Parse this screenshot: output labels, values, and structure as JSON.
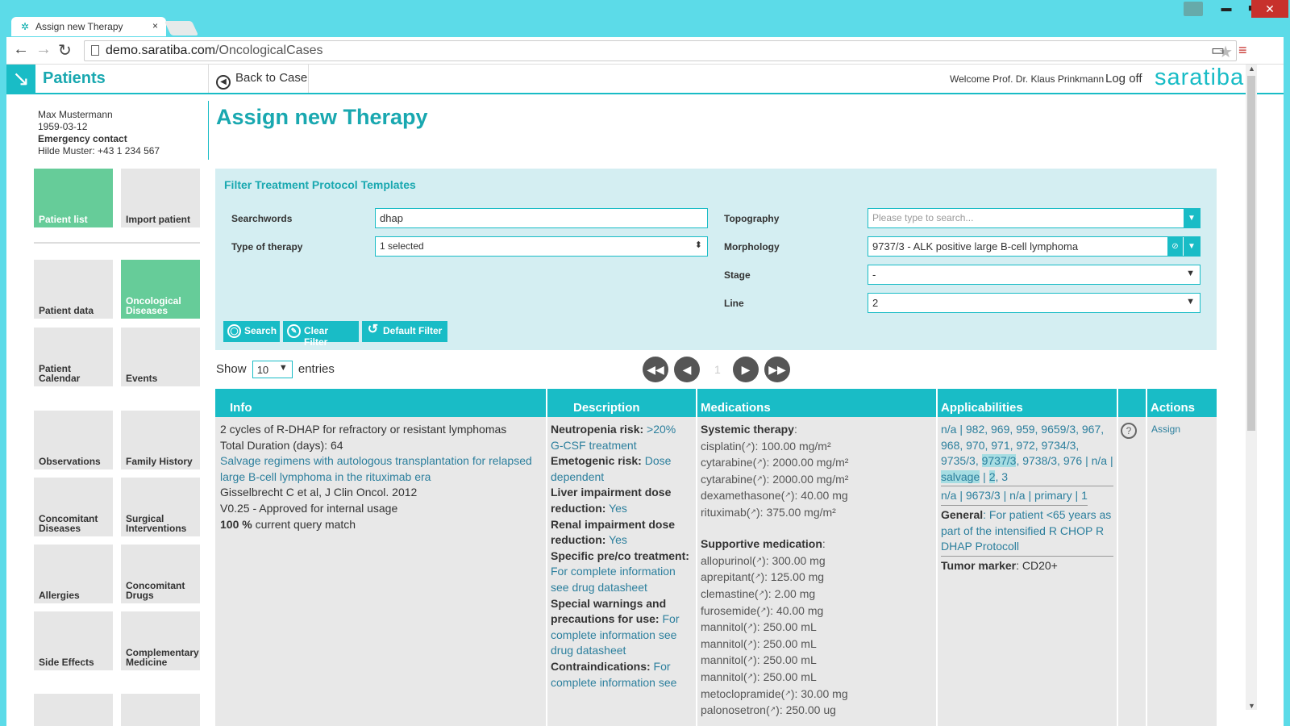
{
  "browser": {
    "tab_title": "Assign new Therapy",
    "tab_close": "×",
    "url_host": "demo.saratiba.com",
    "url_path": "/OncologicalCases",
    "min": "▬",
    "max": "■",
    "close": "✕"
  },
  "header": {
    "app_title": "Patients",
    "back_label": "Back to Case",
    "welcome": "Welcome Prof. Dr. Klaus Prinkmann",
    "logoff": "Log off",
    "brand": "saratiba"
  },
  "patient": {
    "name": "Max Mustermann",
    "dob": "1959-03-12",
    "emergency_label": "Emergency contact",
    "emergency_contact": "Hilde Muster: +43 1 234 567"
  },
  "sidebar": {
    "tiles": [
      {
        "label": "Patient list",
        "active": true
      },
      {
        "label": "Import patient",
        "active": false
      },
      {
        "label": "Patient data",
        "active": false
      },
      {
        "label": "Oncological Diseases",
        "active": true
      },
      {
        "label": "Patient Calendar",
        "active": false
      },
      {
        "label": "Events",
        "active": false
      },
      {
        "label": "Observations",
        "active": false
      },
      {
        "label": "Family History",
        "active": false
      },
      {
        "label": "Concomitant Diseases",
        "active": false
      },
      {
        "label": "Surgical Interventions",
        "active": false
      },
      {
        "label": "Allergies",
        "active": false
      },
      {
        "label": "Concomitant Drugs",
        "active": false
      },
      {
        "label": "Side Effects",
        "active": false
      },
      {
        "label": "Complementary Medicine",
        "active": false
      }
    ]
  },
  "page": {
    "title": "Assign new Therapy"
  },
  "filter": {
    "title": "Filter Treatment Protocol Templates",
    "searchwords_label": "Searchwords",
    "searchwords_value": "dhap",
    "type_label": "Type of therapy",
    "type_value": "1 selected",
    "topography_label": "Topography",
    "topography_placeholder": "Please type to search...",
    "morphology_label": "Morphology",
    "morphology_value": "9737/3 - ALK positive large B-cell lymphoma",
    "stage_label": "Stage",
    "stage_value": "-",
    "line_label": "Line",
    "line_value": "2",
    "search_btn": "Search",
    "clear_btn": "Clear Filter",
    "default_btn": "Default Filter"
  },
  "list": {
    "show_label": "Show",
    "entries_value": "10",
    "entries_label": "entries",
    "page": "1"
  },
  "table": {
    "headers": [
      "Info",
      "Description",
      "Medications",
      "Applicabilities",
      "",
      "Actions"
    ],
    "row": {
      "info": {
        "line1": "2 cycles of R-DHAP for refractory or resistant lymphomas",
        "line2": "Total Duration (days): 64",
        "link": "Salvage regimens with autologous transplantation for relapsed large B-cell lymphoma in the rituximab era",
        "ref": "Gisselbrecht C et al, J Clin Oncol. 2012",
        "version": "V0.25 - Approved for internal usage",
        "match_pct": "100 %",
        "match_text": " current query match"
      },
      "description": [
        {
          "label": "Neutropenia risk:",
          "value": " >20% G-CSF treatment"
        },
        {
          "label": "Emetogenic risk:",
          "value": " Dose dependent"
        },
        {
          "label": "Liver impairment dose reduction:",
          "value": " Yes"
        },
        {
          "label": "Renal impairment dose reduction:",
          "value": " Yes"
        },
        {
          "label": "Specific pre/co treatment:",
          "value": " For complete information see drug datasheet"
        },
        {
          "label": "Special warnings and precautions for use:",
          "value": " For complete information see drug datasheet"
        },
        {
          "label": "Contraindications:",
          "value": " For complete information see"
        }
      ],
      "medications": {
        "systemic_label": "Systemic therapy",
        "systemic": [
          {
            "name": "cisplatin(",
            "dose": "): 100.00 mg/m²"
          },
          {
            "name": "cytarabine(",
            "dose": "): 2000.00 mg/m²"
          },
          {
            "name": "cytarabine(",
            "dose": "): 2000.00 mg/m²"
          },
          {
            "name": "dexamethasone(",
            "dose": "): 40.00 mg"
          },
          {
            "name": "rituximab(",
            "dose": "): 375.00 mg/m²"
          }
        ],
        "supportive_label": "Supportive medication",
        "supportive": [
          {
            "name": "allopurinol(",
            "dose": "): 300.00 mg"
          },
          {
            "name": "aprepitant(",
            "dose": "): 125.00 mg"
          },
          {
            "name": "clemastine(",
            "dose": "): 2.00 mg"
          },
          {
            "name": "furosemide(",
            "dose": "): 40.00 mg"
          },
          {
            "name": "mannitol(",
            "dose": "): 250.00 mL"
          },
          {
            "name": "mannitol(",
            "dose": "): 250.00 mL"
          },
          {
            "name": "mannitol(",
            "dose": "): 250.00 mL"
          },
          {
            "name": "mannitol(",
            "dose": "): 250.00 mL"
          },
          {
            "name": "metoclopramide(",
            "dose": "): 30.00 mg"
          },
          {
            "name": "palonosetron(",
            "dose": "): 250.00 ug"
          }
        ]
      },
      "applicabilities": {
        "a1": "n/a | 982, 969, 959, 9659/3, 967, 968, 970, 971, 972, 9734/3, 9735/3, ",
        "a_hl": "9737/3",
        "a2": ", 9738/3, 976 | n/a | ",
        "a_salvage": "salvage",
        "a3": " | ",
        "a_two": "2",
        "a4": ", 3",
        "b": "n/a | 9673/3 | n/a | primary | 1",
        "general_label": "General",
        "general_value": ": For patient <65 years as part of the intensified R CHOP R DHAP Protocoll",
        "tumor_label": "Tumor marker",
        "tumor_value": ": CD20+"
      },
      "action": "Assign",
      "help": "?"
    }
  }
}
